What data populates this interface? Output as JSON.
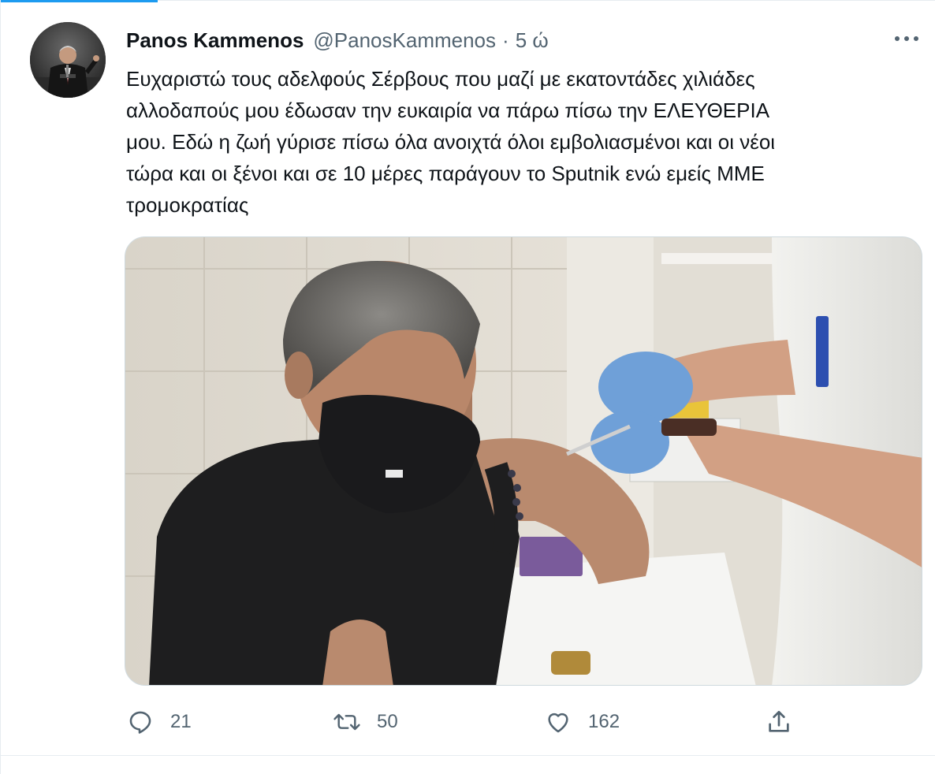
{
  "tweet": {
    "author": {
      "display_name": "Panos Kammenos",
      "handle": "@PanosKammenos",
      "separator": "·",
      "time": "5 ώ"
    },
    "text_lines": [
      "Ευχαριστώ τους αδελφούς Σέρβους που μαζί με εκατοντάδες χιλιάδες",
      "αλλοδαπούς μου έδωσαν την ευκαιρία να πάρω πίσω την ΕΛΕΥΘΕΡΙΑ",
      "μου. Εδώ η ζωή γύρισε πίσω όλα ανοιχτά όλοι εμβολιασμένοι και οι νέοι",
      "τώρα και οι ξένοι και σε 10 μέρες παράγουν το Sputnik ενώ εμείς ΜΜΕ",
      "τρομοκρατίας"
    ],
    "actions": {
      "reply": {
        "icon": "reply-icon",
        "count": "21"
      },
      "retweet": {
        "icon": "retweet-icon",
        "count": "50"
      },
      "like": {
        "icon": "heart-icon",
        "count": "162"
      },
      "share": {
        "icon": "share-icon"
      }
    },
    "more_icon": "more-options-icon"
  },
  "colors": {
    "text_primary": "#0f1419",
    "text_secondary": "#536471",
    "accent": "#1d9bf0",
    "border": "#cfd9de"
  }
}
